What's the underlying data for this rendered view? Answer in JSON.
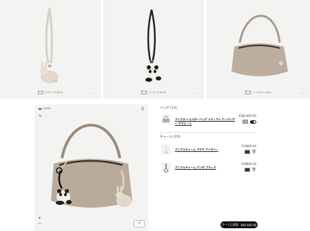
{
  "gallery": [
    {
      "caption": "ウサギ CHARM",
      "likes": "1",
      "item_icon": "rabbit-charm"
    },
    {
      "caption": "パンダ CHARM",
      "likes": "1",
      "item_icon": "panda-charm"
    },
    {
      "caption": "ショルダー BAG",
      "likes": "1",
      "item_icon": "shoulder-bag"
    }
  ],
  "viewer": {
    "logo": "LOEWE",
    "zoom_in": "+",
    "zoom_out": "−"
  },
  "bag_section": {
    "title": "バッグ (1/1)",
    "item_name": "アシスタ ショルダーバッグ ミディアム ナッパレザー グラビーユ",
    "price": "¥382,800.00"
  },
  "charm_section": {
    "title": "チャーム (2/3)",
    "items": [
      {
        "name": "アニマルチャーム ウサギ アイボリー",
        "price": "¥19800.00"
      },
      {
        "name": "アニマルチャーム パンダ ブラック",
        "price": "¥19800.00"
      }
    ]
  },
  "cart": {
    "label": "カートに追加",
    "total": "¥00 440.00"
  },
  "colors": {
    "bag": "#b9aa9b",
    "bag_dark": "#8f8274",
    "background_tile": "#f3f3f2"
  }
}
